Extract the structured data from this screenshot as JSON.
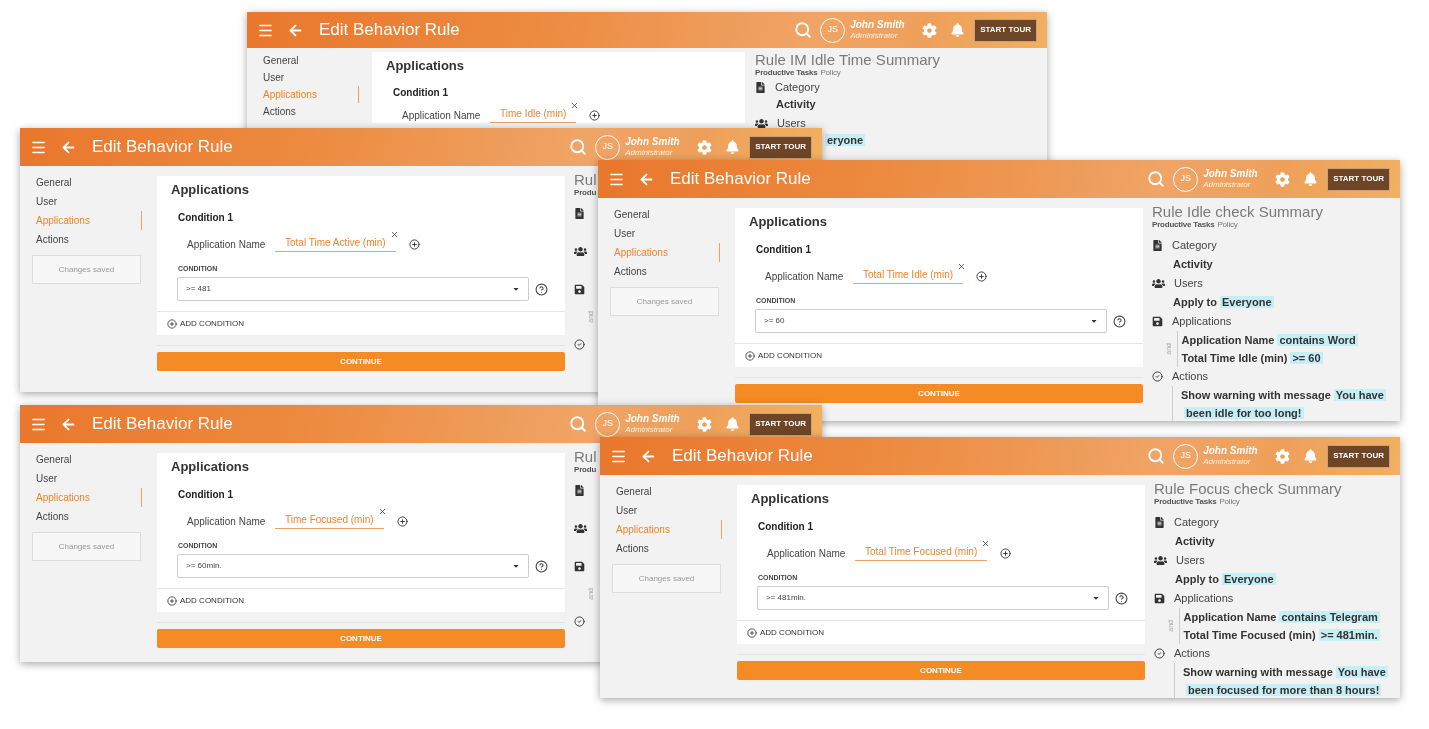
{
  "windows": [
    {
      "title": "Edit Behavior Rule",
      "user": {
        "initials": "JS",
        "name": "John Smith",
        "role": "Administrator"
      },
      "tour_button": "START TOUR",
      "nav": [
        {
          "label": "General",
          "selected": false
        },
        {
          "label": "User",
          "selected": false
        },
        {
          "label": "Applications",
          "selected": true
        },
        {
          "label": "Actions",
          "selected": false
        }
      ],
      "section_title": "Applications",
      "condition_title": "Condition 1",
      "field_label": "Application Name",
      "field_value": "Time Idle (min)",
      "summary": {
        "title": "Rule IM Idle Time Summary",
        "policy_name": "Productive Tasks",
        "policy_suffix": "Policy",
        "sections": [
          {
            "kind": "category",
            "label": "Category",
            "lines": [
              {
                "text": "Activity"
              }
            ]
          },
          {
            "kind": "users",
            "label": "Users",
            "lines": [
              {
                "highlight": "eryone"
              }
            ]
          }
        ]
      }
    },
    {
      "title": "Edit Behavior Rule",
      "user": {
        "initials": "JS",
        "name": "John Smith",
        "role": "Administrator"
      },
      "tour_button": "START TOUR",
      "nav": [
        {
          "label": "General",
          "selected": false
        },
        {
          "label": "User",
          "selected": false
        },
        {
          "label": "Applications",
          "selected": true
        },
        {
          "label": "Actions",
          "selected": false
        }
      ],
      "status": "Changes saved",
      "section_title": "Applications",
      "condition_title": "Condition 1",
      "field_label": "Application Name",
      "field_value": "Total Time Active (min)",
      "condition_label": "CONDITION",
      "condition_value": ">= 481",
      "add_condition": "ADD CONDITION",
      "continue": "CONTINUE",
      "summary": {
        "title": "Rul",
        "policy_name": "Produ",
        "sections": [
          {
            "kind": "category"
          },
          {
            "kind": "users"
          },
          {
            "kind": "applications",
            "connector": "and"
          },
          {
            "kind": "actions"
          }
        ]
      }
    },
    {
      "title": "Edit Behavior Rule",
      "user": {
        "initials": "JS",
        "name": "John Smith",
        "role": "Administrator"
      },
      "tour_button": "START TOUR",
      "nav": [
        {
          "label": "General",
          "selected": false
        },
        {
          "label": "User",
          "selected": false
        },
        {
          "label": "Applications",
          "selected": true
        },
        {
          "label": "Actions",
          "selected": false
        }
      ],
      "status": "Changes saved",
      "section_title": "Applications",
      "condition_title": "Condition 1",
      "field_label": "Application Name",
      "field_value": "Total Time Idle (min)",
      "condition_label": "CONDITION",
      "condition_value": ">= 60",
      "add_condition": "ADD CONDITION",
      "continue": "CONTINUE",
      "summary": {
        "title": "Rule Idle check Summary",
        "policy_name": "Productive Tasks",
        "policy_suffix": "Policy",
        "sections": [
          {
            "kind": "category",
            "label": "Category",
            "lines": [
              {
                "text": "Activity"
              }
            ]
          },
          {
            "kind": "users",
            "label": "Users",
            "lines": [
              {
                "text": "Apply to",
                "highlight": "Everyone"
              }
            ]
          },
          {
            "kind": "applications",
            "label": "Applications",
            "connector": "and",
            "lines": [
              {
                "text": "Application Name",
                "highlight": "contains Word"
              },
              {
                "text": "Total Time Idle (min)",
                "highlight": ">=  60"
              }
            ]
          },
          {
            "kind": "actions",
            "label": "Actions",
            "lines": [
              {
                "text": "Show warning with message",
                "highlight": "You have been idle for too long!"
              }
            ]
          }
        ]
      }
    },
    {
      "title": "Edit Behavior Rule",
      "user": {
        "initials": "JS",
        "name": "John Smith",
        "role": "Administrator"
      },
      "tour_button": "START TOUR",
      "nav": [
        {
          "label": "General",
          "selected": false
        },
        {
          "label": "User",
          "selected": false
        },
        {
          "label": "Applications",
          "selected": true
        },
        {
          "label": "Actions",
          "selected": false
        }
      ],
      "status": "Changes saved",
      "section_title": "Applications",
      "condition_title": "Condition 1",
      "field_label": "Application Name",
      "field_value": "Time Focused (min)",
      "condition_label": "CONDITION",
      "condition_value": ">= 60min.",
      "add_condition": "ADD CONDITION",
      "continue": "CONTINUE",
      "summary": {
        "title": "Rul",
        "policy_name": "Produ",
        "sections": [
          {
            "kind": "category"
          },
          {
            "kind": "users"
          },
          {
            "kind": "applications",
            "connector": "and"
          },
          {
            "kind": "actions"
          }
        ]
      }
    },
    {
      "title": "Edit Behavior Rule",
      "user": {
        "initials": "JS",
        "name": "John Smith",
        "role": "Administrator"
      },
      "tour_button": "START TOUR",
      "nav": [
        {
          "label": "General",
          "selected": false
        },
        {
          "label": "User",
          "selected": false
        },
        {
          "label": "Applications",
          "selected": true
        },
        {
          "label": "Actions",
          "selected": false
        }
      ],
      "status": "Changes saved",
      "section_title": "Applications",
      "condition_title": "Condition 1",
      "field_label": "Application Name",
      "field_value": "Total Time Focused (min)",
      "condition_label": "CONDITION",
      "condition_value": ">= 481min.",
      "add_condition": "ADD CONDITION",
      "continue": "CONTINUE",
      "summary": {
        "title": "Rule Focus check Summary",
        "policy_name": "Productive Tasks",
        "policy_suffix": "Policy",
        "sections": [
          {
            "kind": "category",
            "label": "Category",
            "lines": [
              {
                "text": "Activity"
              }
            ]
          },
          {
            "kind": "users",
            "label": "Users",
            "lines": [
              {
                "text": "Apply to",
                "highlight": "Everyone"
              }
            ]
          },
          {
            "kind": "applications",
            "label": "Applications",
            "connector": "and",
            "lines": [
              {
                "text": "Application Name",
                "highlight": "contains Telegram"
              },
              {
                "text": "Total Time Focused (min)",
                "highlight": ">=  481min."
              }
            ]
          },
          {
            "kind": "actions",
            "label": "Actions",
            "lines": [
              {
                "text": "Show warning with message",
                "highlight": "You have been focused for more than 8 hours!"
              }
            ]
          }
        ]
      }
    }
  ]
}
